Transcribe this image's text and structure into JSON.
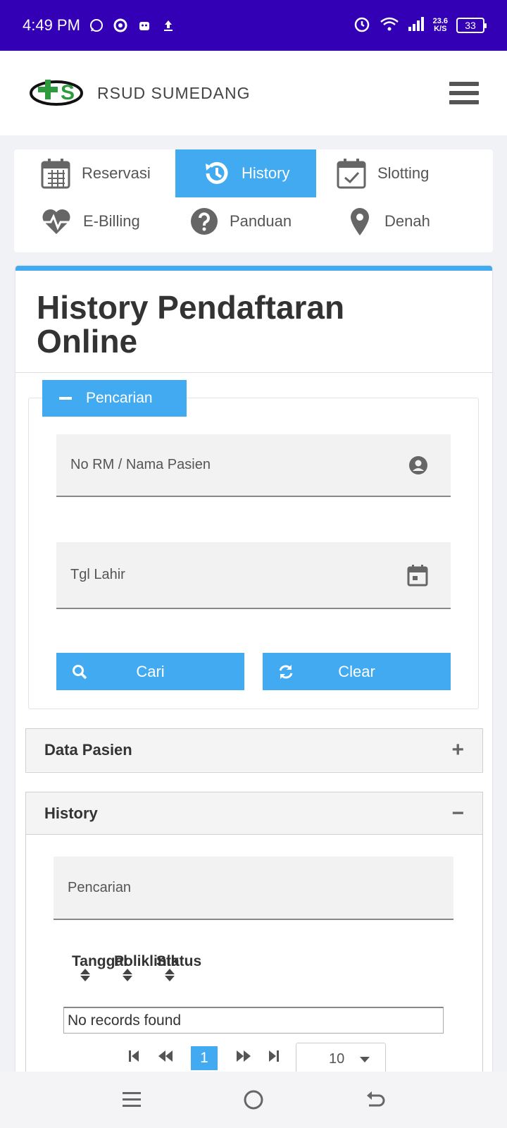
{
  "status_bar": {
    "time": "4:49 PM",
    "net_speed_value": "23.6",
    "net_speed_unit": "K/S",
    "battery": "33",
    "icons": [
      "whatsapp-icon",
      "location-icon",
      "robot-icon",
      "upload-icon",
      "alarm-icon",
      "wifi-icon",
      "signal-icon"
    ]
  },
  "header": {
    "brand": "RSUD SUMEDANG",
    "logo_text": "S"
  },
  "menu": {
    "items": [
      {
        "label": "Reservasi",
        "icon": "calendar-icon",
        "active": false
      },
      {
        "label": "History",
        "icon": "history-icon",
        "active": true
      },
      {
        "label": "Slotting",
        "icon": "calendar-check-icon",
        "active": false
      },
      {
        "label": "E-Billing",
        "icon": "heartbeat-icon",
        "active": false
      },
      {
        "label": "Panduan",
        "icon": "question-icon",
        "active": false
      },
      {
        "label": "Denah",
        "icon": "map-pin-icon",
        "active": false
      }
    ]
  },
  "page": {
    "title_line1": "History Pendaftaran",
    "title_line2": "Online"
  },
  "search": {
    "legend": "Pencarian",
    "name_placeholder": "No RM / Nama Pasien",
    "dob_placeholder": "Tgl Lahir",
    "search_button": "Cari",
    "clear_button": "Clear"
  },
  "panels": {
    "patient": {
      "title": "Data Pasien",
      "toggle": "+"
    },
    "history": {
      "title": "History",
      "toggle": "−"
    }
  },
  "history_table": {
    "filter_placeholder": "Pencarian",
    "columns": [
      "Tanggal",
      "Poliklinik",
      "Status"
    ],
    "empty_message": "No records found"
  },
  "pagination": {
    "current_page": "1",
    "rows_per_page": "10"
  },
  "colors": {
    "status_bar": "#3300b5",
    "accent": "#42aaf0"
  }
}
